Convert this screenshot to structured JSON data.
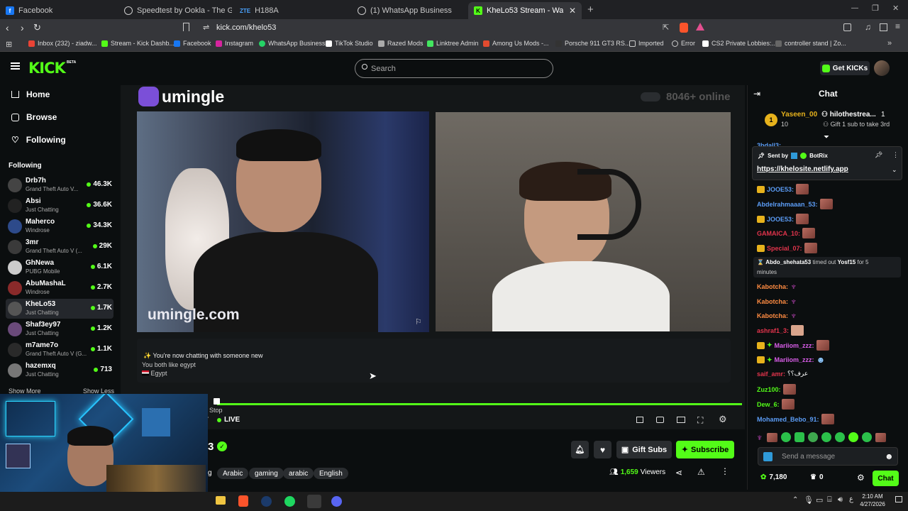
{
  "browser": {
    "tabs": [
      {
        "label": "Facebook"
      },
      {
        "label": "Speedtest by Ookla - The Global Bro"
      },
      {
        "label": "H188A"
      },
      {
        "label": "(1) WhatsApp Business"
      },
      {
        "label": "KheLo53 Stream - Watch Live on"
      }
    ],
    "url": "kick.com/khelo53",
    "bookmarks": [
      "Inbox (232) - ziadw...",
      "Stream - Kick Dashb...",
      "Facebook",
      "Instagram",
      "WhatsApp Business",
      "TikTok Studio",
      "Razed Mods",
      "Linktree Admin",
      "Among Us Mods -...",
      "Porsche 911 GT3 RS...",
      "Imported",
      "Error",
      "CS2 Private Lobbies:...",
      "controller stand | Zo..."
    ]
  },
  "header": {
    "logo": "KICK",
    "logo_badge": "BETA",
    "search_placeholder": "Search",
    "get_kicks": "Get KICKs"
  },
  "sidebar": {
    "nav": [
      {
        "label": "Home"
      },
      {
        "label": "Browse"
      },
      {
        "label": "Following"
      }
    ],
    "following_title": "Following",
    "channels": [
      {
        "name": "Drb7h",
        "game": "Grand Theft Auto V...",
        "viewers": "46.3K"
      },
      {
        "name": "Absi",
        "game": "Just Chatting",
        "viewers": "36.6K"
      },
      {
        "name": "Maherco",
        "game": "Windrose",
        "viewers": "34.3K"
      },
      {
        "name": "3mr",
        "game": "Grand Theft Auto V (...",
        "viewers": "29K"
      },
      {
        "name": "GhNewa",
        "game": "PUBG Mobile",
        "viewers": "6.1K"
      },
      {
        "name": "AbuMashaL",
        "game": "Windrose",
        "viewers": "2.7K"
      },
      {
        "name": "KheLo53",
        "game": "Just Chatting",
        "viewers": "1.7K"
      },
      {
        "name": "Shaf3ey97",
        "game": "Just Chatting",
        "viewers": "1.2K"
      },
      {
        "name": "m7ame7o",
        "game": "Grand Theft Auto V (G...",
        "viewers": "1.1K"
      },
      {
        "name": "hazemxq",
        "game": "Just Chatting",
        "viewers": "713"
      }
    ],
    "show_more": "Show More",
    "show_less": "Show Less"
  },
  "player": {
    "umingle_logo": "umingle",
    "online_count": "8046+ online",
    "watermark": "umingle.com",
    "notice": "You're now chatting with someone new",
    "both_like": "You both like egypt",
    "country": "Egypt",
    "stop_label": "Stop",
    "live_label": "LIVE",
    "progress": 1.0
  },
  "stream_info": {
    "title_fragment": "3",
    "tags": [
      "Arabic",
      "gaming",
      "arabic",
      "English"
    ],
    "tag_fragment": "g",
    "viewers": "1,659",
    "viewers_label": "Viewers",
    "gift_subs": "Gift Subs",
    "subscribe": "Subscribe"
  },
  "chat": {
    "title": "Chat",
    "leaderboard": {
      "first_name": "Yaseen_00",
      "first_count": "10",
      "second_name": "hilothestrea...",
      "second_count": "1",
      "gift_text": "Gift 1 sub to take 3rd"
    },
    "partial_user": "3bdall3:",
    "pinned": {
      "sent_by": "Sent by",
      "bot": "BotRix",
      "link": "https://khelosite.netlify.app"
    },
    "messages": [
      {
        "user": "JOOE53:",
        "color": "#ffd23c"
      },
      {
        "user": "Abdelrahmaaan_53:",
        "color": "#5b9cf5"
      },
      {
        "user": "JOOE53:",
        "color": "#ffd23c"
      },
      {
        "user": "GAMAICA_10:",
        "color": "#e2344c"
      },
      {
        "user": "Special_07:",
        "color": "#e2344c"
      }
    ],
    "timeout": {
      "user": "Abdo_shehata53",
      "text": "timed out",
      "target": "Yosf15",
      "suffix": "for 5",
      "line2": "minutes"
    },
    "messages2": [
      {
        "user": "Kabotcha:",
        "color": "#ff8c42"
      },
      {
        "user": "Kabotcha:",
        "color": "#ff8c42"
      },
      {
        "user": "Kabotcha:",
        "color": "#ff8c42"
      },
      {
        "user": "ashraf1_3:",
        "color": "#e2344c"
      },
      {
        "user": "Mariiom_zzz:",
        "color": "#d85de8"
      },
      {
        "user": "Mariiom_zzz:",
        "color": "#d85de8"
      },
      {
        "user": "saif_amr:",
        "color": "#e2344c",
        "text": "عرف؟؟"
      },
      {
        "user": "Zuz100:",
        "color": "#53fc18"
      },
      {
        "user": "Dew_6:",
        "color": "#53fc18"
      },
      {
        "user": "Mohamed_Bebo_91:",
        "color": "#5b9cf5"
      }
    ],
    "input_placeholder": "Send a message",
    "kicks": "7,180",
    "points": "0",
    "send": "Chat"
  },
  "taskbar": {
    "time": "2:10 AM",
    "date": "4/27/2026"
  },
  "colors": {
    "accent": "#53fc18",
    "bg": "#0b0e0f"
  }
}
